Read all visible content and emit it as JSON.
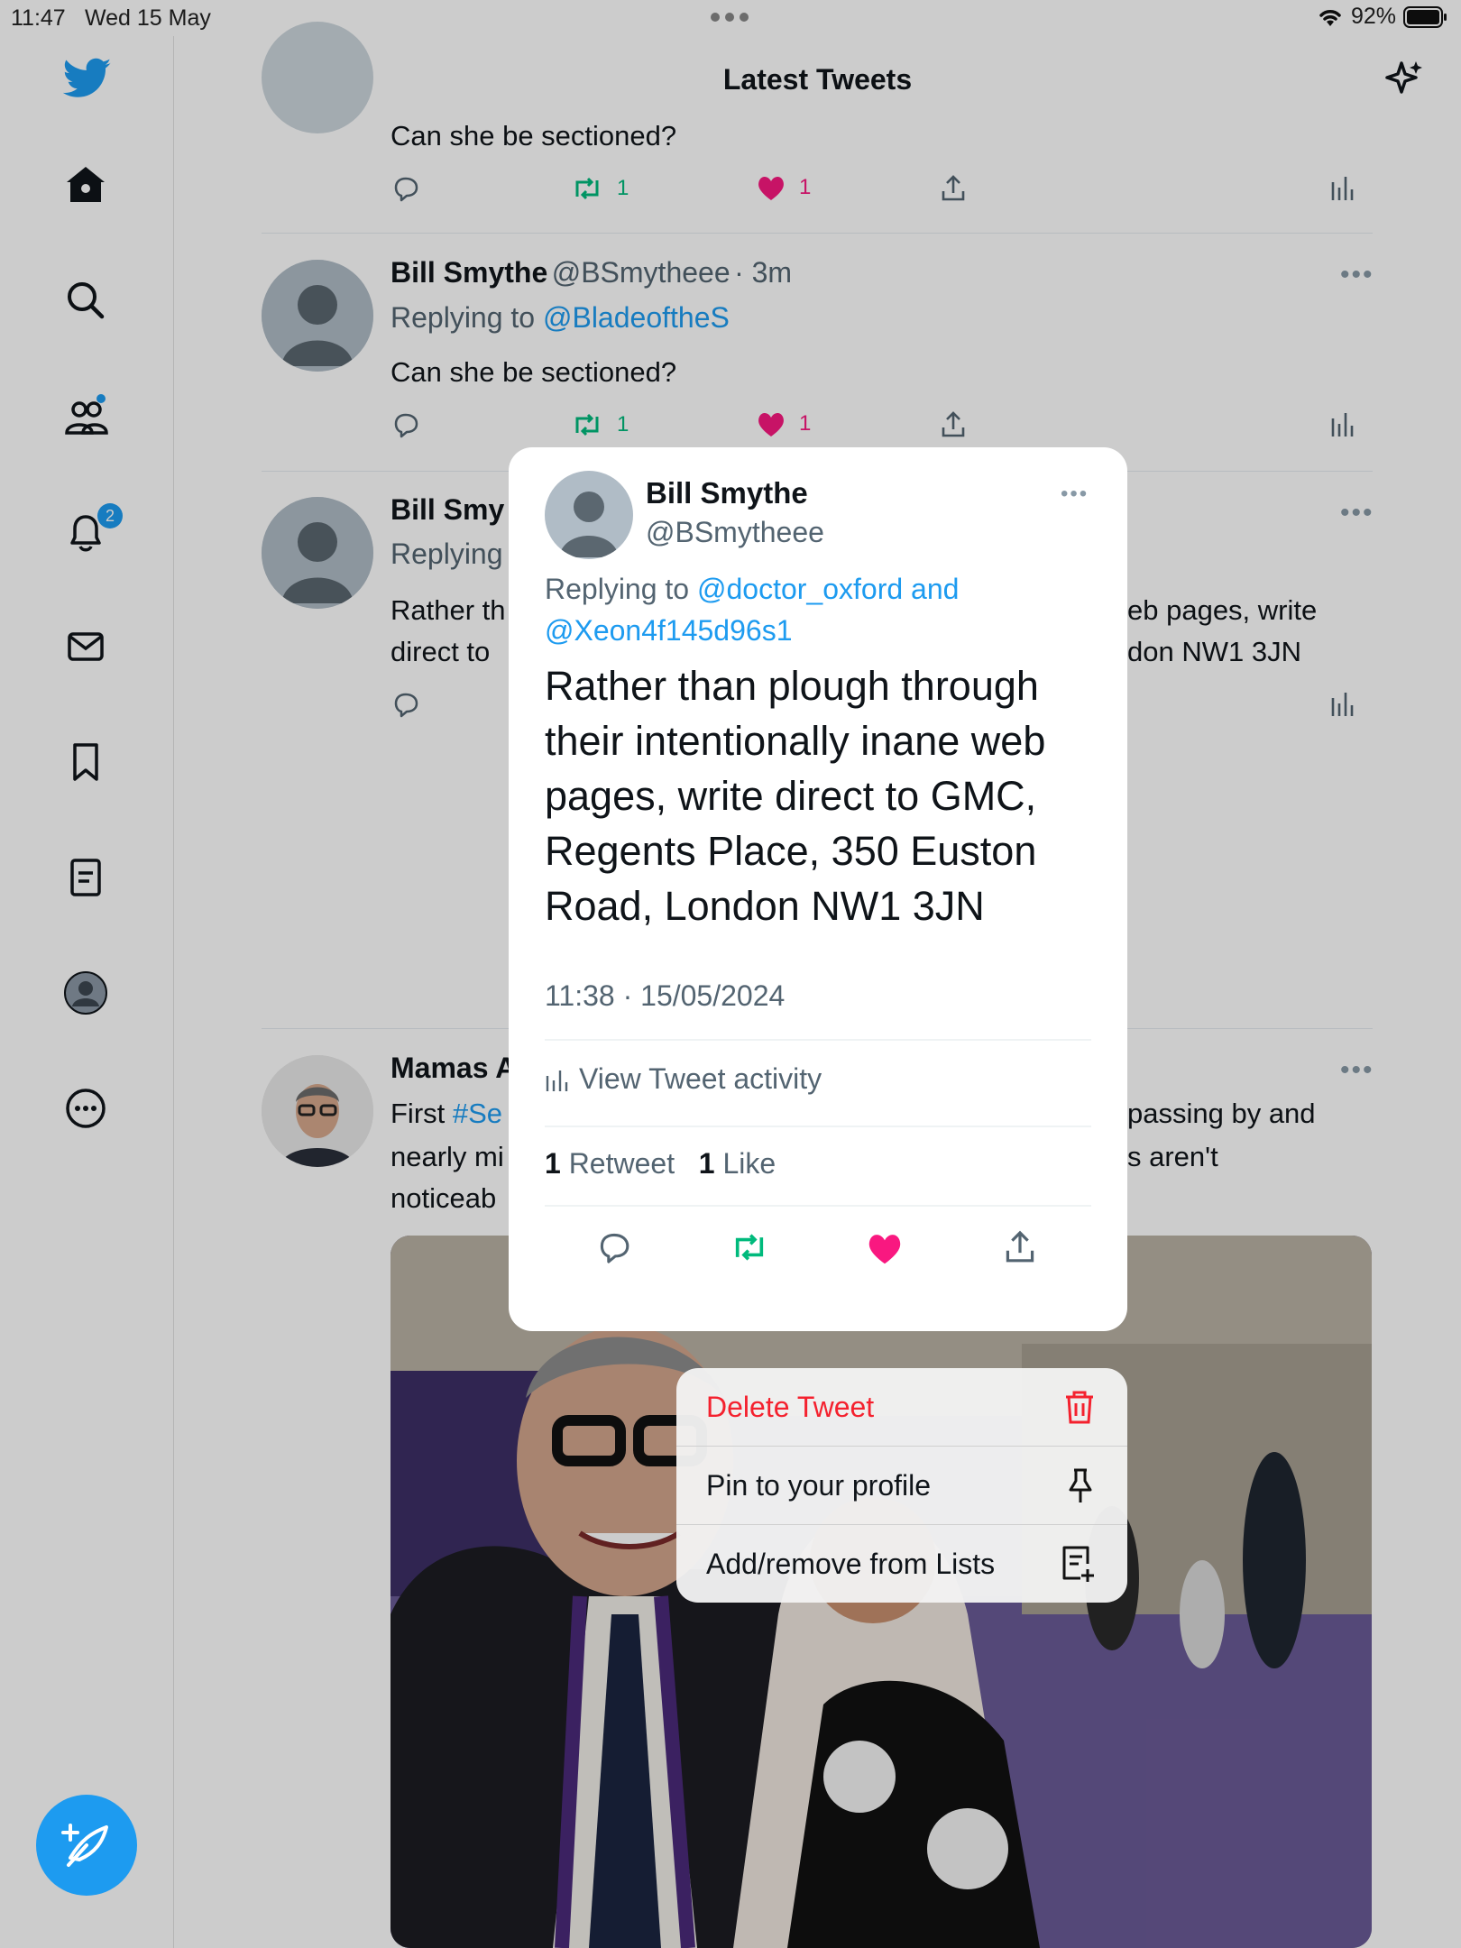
{
  "status_bar": {
    "time": "11:47",
    "date": "Wed 15 May",
    "battery": "92%"
  },
  "header": {
    "title": "Latest Tweets"
  },
  "sidebar": {
    "items": [
      {
        "icon": "home-icon"
      },
      {
        "icon": "search-icon"
      },
      {
        "icon": "communities-icon"
      },
      {
        "icon": "notifications-icon",
        "badge": "2"
      },
      {
        "icon": "messages-icon"
      },
      {
        "icon": "bookmarks-icon"
      },
      {
        "icon": "lists-icon"
      },
      {
        "icon": "profile-icon"
      },
      {
        "icon": "more-icon"
      }
    ]
  },
  "feed": {
    "tweet0": {
      "text": "Can she be sectioned?",
      "retweets": "1",
      "likes": "1"
    },
    "tweet1": {
      "name": "Bill Smythe",
      "handle": "@BSmytheee",
      "time": "· 3m",
      "replying_prefix": "Replying to",
      "replying_to": "@BladeoftheS",
      "text": "Can she be sectioned?",
      "retweets": "1",
      "likes": "1"
    },
    "tweet2": {
      "name_partial": "Bill Smy",
      "replying_partial": "Replying",
      "text_left_1": "Rather th",
      "text_left_2": "direct to",
      "text_right_1": "eb pages, write",
      "text_right_2": "don NW1 3JN"
    },
    "tweet3": {
      "name_partial": "Mamas A",
      "line1_left": "First ",
      "line1_hashtag": "#Se",
      "line1_right": "passing by and",
      "line2_left": "nearly mi",
      "line2_right": "s aren't",
      "line3_left": "noticeab"
    }
  },
  "popup": {
    "name": "Bill Smythe",
    "handle": "@BSmytheee",
    "replying_prefix": "Replying to ",
    "replying_to_1": "@doctor_oxford and",
    "replying_to_2": "@Xeon4f145d96s1",
    "body": "Rather than plough through their intentionally inane web pages, write direct to GMC, Regents Place, 350 Euston Road, London NW1 3JN",
    "timestamp": "11:38 · 15/05/2024",
    "activity_label": "View Tweet activity",
    "retweet_count": "1",
    "retweet_label": "Retweet",
    "like_count": "1",
    "like_label": "Like"
  },
  "context_menu": {
    "items": [
      {
        "label": "Delete Tweet",
        "icon": "trash-icon",
        "color": "#f4212e"
      },
      {
        "label": "Pin to your profile",
        "icon": "pin-icon"
      },
      {
        "label": "Add/remove from Lists",
        "icon": "list-add-icon"
      }
    ]
  },
  "colors": {
    "accent": "#1d9bf0",
    "retweet": "#00ba7c",
    "like": "#f91880",
    "destructive": "#f4212e"
  }
}
